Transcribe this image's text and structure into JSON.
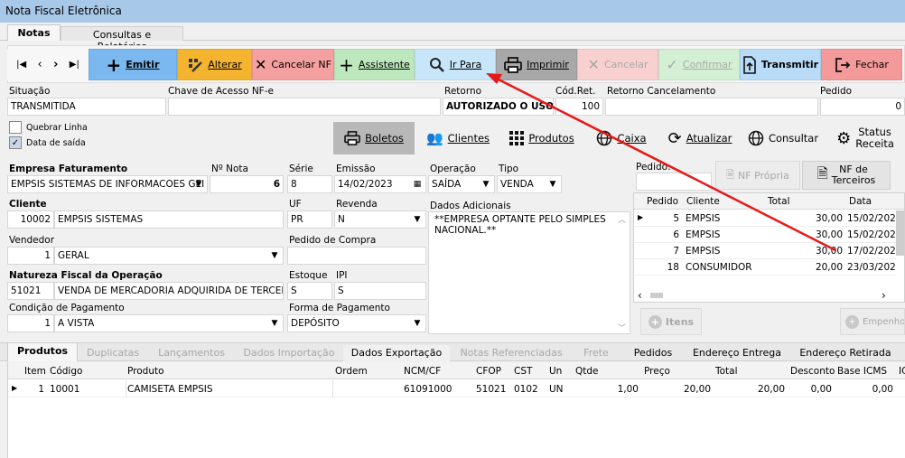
{
  "window": {
    "title": "Nota Fiscal Eletrônica"
  },
  "top_tabs": [
    "Notas",
    "Consultas e Relatórios"
  ],
  "toolbar": {
    "emitir": "Emitir",
    "alterar": "Alterar",
    "cancelar_nf": "Cancelar NF",
    "assistente": "Assistente",
    "ir_para": "Ir Para",
    "imprimir": "Imprimir",
    "cancelar": "Cancelar",
    "confirmar": "Confirmar",
    "transmitir": "Transmitir",
    "fechar": "Fechar"
  },
  "header": {
    "situacao_label": "Situação",
    "situacao": "TRANSMITIDA",
    "chave_label": "Chave de Acesso NF-e",
    "chave": "",
    "retorno_label": "Retorno",
    "retorno": "AUTORIZADO O USO",
    "codret_label": "Cód.Ret.",
    "codret": "100",
    "retcanc_label": "Retorno Cancelamento",
    "retcanc": "",
    "pedido_label": "Pedido",
    "pedido": "0"
  },
  "options": {
    "quebrar_linha": "Quebrar Linha",
    "data_saida": "Data de saída"
  },
  "func_buttons": {
    "boletos": "Boletos",
    "clientes": "Clientes",
    "produtos": "Produtos",
    "caixa": "Caixa",
    "atualizar": "Atualizar",
    "consultar": "Consultar",
    "status1": "Status",
    "status2": "Receita"
  },
  "form": {
    "empresa_label": "Empresa Faturamento",
    "empresa": "EMPSIS SISTEMAS DE INFORMACOES GEI",
    "nnota_label": "Nº Nota",
    "nnota": "6",
    "serie_label": "Série",
    "serie": "8",
    "emissao_label": "Emissão",
    "emissao": "14/02/2023",
    "operacao_label": "Operação",
    "operacao": "SAÍDA",
    "tipo_label": "Tipo",
    "tipo": "VENDA",
    "cliente_label": "Cliente",
    "cliente_cod": "10002",
    "cliente_nome": "EMPSIS SISTEMAS",
    "uf_label": "UF",
    "uf": "PR",
    "revenda_label": "Revenda",
    "revenda": "N",
    "dados_label": "Dados Adicionais",
    "dados": "**EMPRESA OPTANTE PELO SIMPLES NACIONAL.**",
    "vendedor_label": "Vendedor",
    "vendedor_cod": "1",
    "vendedor_nome": "GERAL",
    "pedcompra_label": "Pedido de Compra",
    "pedcompra": "",
    "natureza_label": "Natureza Fiscal da Operação",
    "natureza_cod": "51021",
    "natureza_desc": "VENDA DE MERCADORIA ADQUIRIDA DE TERCEIR",
    "estoque_label": "Estoque",
    "estoque": "S",
    "ipi_label": "IPI",
    "ipi": "S",
    "condpag_label": "Condição de Pagamento",
    "condpag_cod": "1",
    "condpag": "A VISTA",
    "formapag_label": "Forma de Pagamento",
    "formapag": "DEPÓSITO"
  },
  "side": {
    "pedido_label": "Pedido:",
    "nf_propria": "NF Própria",
    "nf_terceiros1": "NF de",
    "nf_terceiros2": "Terceiros",
    "columns": [
      "Pedido",
      "Cliente",
      "Total",
      "Data"
    ],
    "rows": [
      [
        "5",
        "EMPSIS",
        "30,00",
        "15/02/202"
      ],
      [
        "6",
        "EMPSIS",
        "30,00",
        "15/02/202"
      ],
      [
        "7",
        "EMPSIS",
        "30,00",
        "17/02/202"
      ],
      [
        "18",
        "CONSUMIDOR",
        "20,00",
        "23/03/202"
      ]
    ],
    "itens": "Itens",
    "empenho": "Empenho"
  },
  "bottom_tabs": [
    "Produtos",
    "Duplicatas",
    "Lançamentos",
    "Dados Importação",
    "Dados Exportação",
    "Notas Referenciadas",
    "Frete",
    "Pedidos",
    "Endereço Entrega",
    "Endereço Retirada"
  ],
  "products": {
    "columns": [
      "Item",
      "Código",
      "Produto",
      "Ordem",
      "NCM/CF",
      "CFOP",
      "CST",
      "Un",
      "Qtde",
      "Preço",
      "Total",
      "Desconto",
      "Base ICMS",
      "IC"
    ],
    "rows": [
      [
        "1",
        "10001",
        "CAMISETA EMPSIS",
        "",
        "61091000",
        "51021",
        "0102",
        "UN",
        "1,00",
        "20,00",
        "20,00",
        "0,00",
        "0,00",
        ""
      ]
    ]
  },
  "colors": {
    "emitir": "#7cb8f0",
    "alterar": "#f5b430",
    "cancelar_nf": "#f5a0a0",
    "assistente": "#bde8bd",
    "ir_para": "#c8e6fa",
    "imprimir": "#a8a8a8",
    "transmitir": "#b8dcf8",
    "fechar": "#f59a9a",
    "arrow": "#e81818"
  }
}
